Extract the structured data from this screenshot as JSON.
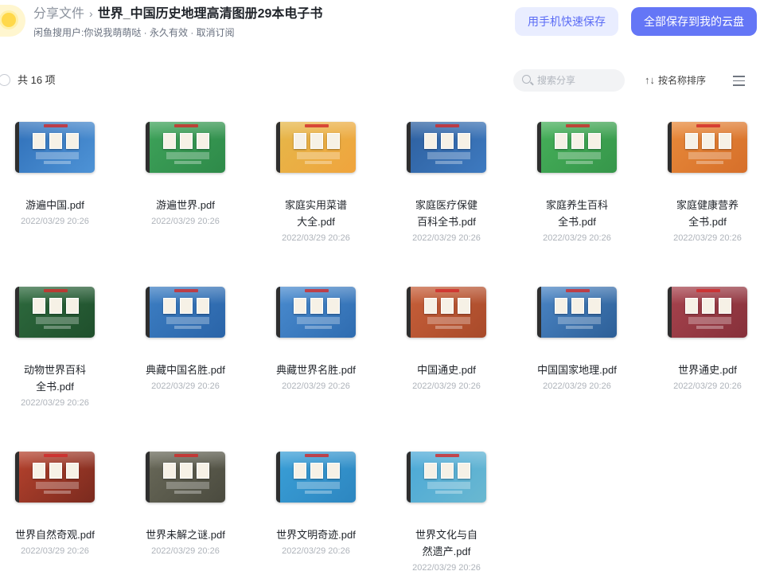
{
  "header": {
    "breadcrumb_root": "分享文件",
    "breadcrumb_sep": "›",
    "title": "世界_中国历史地理高清图册29本电子书",
    "subline": "闲鱼搜用户:你说我萌萌哒 · 永久有效 · 取消订阅",
    "phone_save_label": "用手机快速保存",
    "save_all_label": "全部保存到我的云盘"
  },
  "toolbar": {
    "count_label": "共 16 项",
    "search_placeholder": "搜索分享",
    "sort_icon": "↑↓",
    "sort_label": "按名称排序"
  },
  "colors": {
    "accent": "#6476f6",
    "accent_light": "#e9edff"
  },
  "files": [
    {
      "name": "游遍中国.pdf",
      "date": "2022/03/29 20:26",
      "cover": [
        "#2f6fb8",
        "#4e93d6"
      ]
    },
    {
      "name": "游遍世界.pdf",
      "date": "2022/03/29 20:26",
      "cover": [
        "#3ea35a",
        "#2e8a49"
      ]
    },
    {
      "name": "家庭实用菜谱大全.pdf",
      "date": "2022/03/29 20:26",
      "cover": [
        "#e5b84a",
        "#f0a43d"
      ]
    },
    {
      "name": "家庭医疗保健百科全书.pdf",
      "date": "2022/03/29 20:26",
      "cover": [
        "#2d5f9e",
        "#3e7ac0"
      ]
    },
    {
      "name": "家庭养生百科全书.pdf",
      "date": "2022/03/29 20:26",
      "cover": [
        "#46b05a",
        "#36964a"
      ]
    },
    {
      "name": "家庭健康营养全书.pdf",
      "date": "2022/03/29 20:26",
      "cover": [
        "#e88a3a",
        "#d66f2a"
      ]
    },
    {
      "name": "动物世界百科全书.pdf",
      "date": "2022/03/29 20:26",
      "cover": [
        "#2e6b3e",
        "#1f4f2c"
      ]
    },
    {
      "name": "典藏中国名胜.pdf",
      "date": "2022/03/29 20:26",
      "cover": [
        "#3d7fc4",
        "#2a64a8"
      ]
    },
    {
      "name": "典藏世界名胜.pdf",
      "date": "2022/03/29 20:26",
      "cover": [
        "#4a8cd0",
        "#2f6cb0"
      ]
    },
    {
      "name": "中国通史.pdf",
      "date": "2022/03/29 20:26",
      "cover": [
        "#c8603a",
        "#a84a2a"
      ]
    },
    {
      "name": "中国国家地理.pdf",
      "date": "2022/03/29 20:26",
      "cover": [
        "#4b86c6",
        "#2d5f97"
      ]
    },
    {
      "name": "世界通史.pdf",
      "date": "2022/03/29 20:26",
      "cover": [
        "#a8444e",
        "#86303a"
      ]
    },
    {
      "name": "世界自然奇观.pdf",
      "date": "2022/03/29 20:26",
      "cover": [
        "#b8432e",
        "#7a2a1e"
      ]
    },
    {
      "name": "世界未解之谜.pdf",
      "date": "2022/03/29 20:26",
      "cover": [
        "#6a6a5a",
        "#4a4a3e"
      ]
    },
    {
      "name": "世界文明奇迹.pdf",
      "date": "2022/03/29 20:26",
      "cover": [
        "#3aa0d8",
        "#2d86c0"
      ]
    },
    {
      "name": "世界文化与自然遗产.pdf",
      "date": "2022/03/29 20:26",
      "cover": [
        "#4aa8d8",
        "#6ab8d0"
      ]
    }
  ]
}
